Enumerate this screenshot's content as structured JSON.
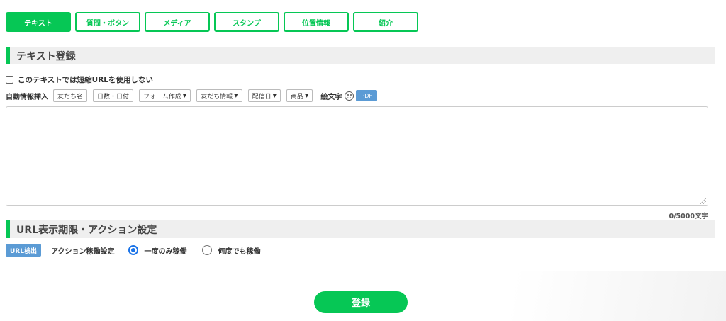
{
  "tabs": [
    {
      "label": "テキスト",
      "active": true
    },
    {
      "label": "質問・ボタン",
      "active": false
    },
    {
      "label": "メディア",
      "active": false
    },
    {
      "label": "スタンプ",
      "active": false
    },
    {
      "label": "位置情報",
      "active": false
    },
    {
      "label": "紹介",
      "active": false
    }
  ],
  "text_section": {
    "title": "テキスト登録",
    "short_url_checkbox_label": "このテキストでは短縮URLを使用しない",
    "short_url_checked": false,
    "insert_label": "自動情報挿入",
    "insert_buttons": {
      "friend_name": "友だち名",
      "days_date": "日数・日付",
      "form_create": "フォーム作成",
      "friend_info": "友だち情報",
      "delivery_date": "配信日",
      "product": "商品"
    },
    "emoji_label": "絵文字",
    "pdf_label": "PDF",
    "textarea_value": "",
    "char_count": "0/5000文字"
  },
  "url_section": {
    "title": "URL表示期限・アクション設定",
    "url_detect_label": "URL検出",
    "action_label": "アクション稼働設定",
    "radio_options": [
      {
        "label": "一度のみ稼働",
        "checked": true
      },
      {
        "label": "何度でも稼働",
        "checked": false
      }
    ]
  },
  "submit_label": "登録",
  "colors": {
    "brand_green": "#06c755",
    "accent_blue": "#5b9bd5",
    "radio_blue": "#1a73e8"
  }
}
